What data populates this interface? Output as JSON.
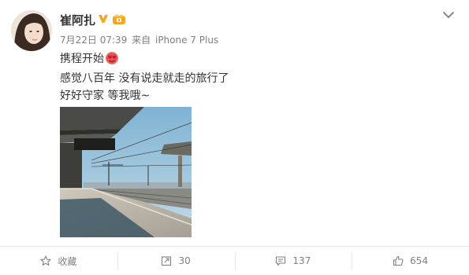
{
  "post": {
    "username": "崔阿扎",
    "date": "7月22日 07:39",
    "source_prefix": "来自",
    "source_device": "iPhone 7 Plus",
    "line1": "携程开始",
    "line2": "感觉八百年 没有说走就走的旅行了",
    "line3": "好好守家 等我哦~"
  },
  "icons": {
    "verified": "verified-v-icon",
    "level": "vip-crown-icon",
    "emoji": "heart-eyes-emoji-icon",
    "menu": "chevron-down-icon"
  },
  "toolbar": {
    "favorite_label": "收藏",
    "repost_count": "30",
    "comment_count": "137",
    "like_count": "654"
  },
  "colors": {
    "verified": "#f5a623",
    "level": "#f5a623",
    "emoji": "#e0245e",
    "meta_text": "#808080"
  }
}
